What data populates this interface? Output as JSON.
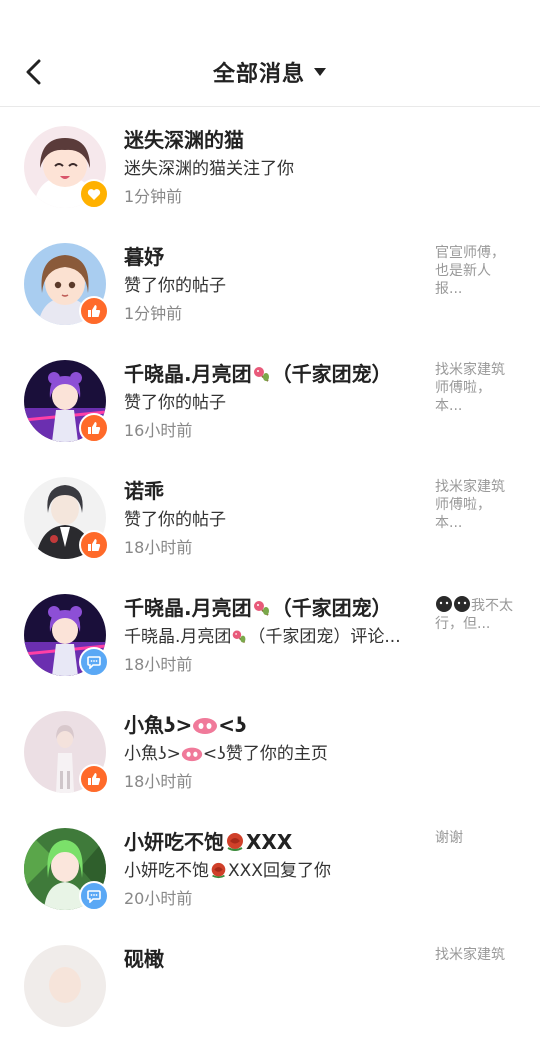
{
  "header": {
    "title": "全部消息"
  },
  "notifications": [
    {
      "name": "迷失深渊的猫",
      "action": "迷失深渊的猫关注了你",
      "time": "1分钟前",
      "preview": "",
      "badge": "heart-icon"
    },
    {
      "name": "暮妤",
      "action": "赞了你的帖子",
      "time": "1分钟前",
      "preview": "官宣师傅，也是新人报...",
      "badge": "thumbs-up-icon"
    },
    {
      "name": "千晓晶.月亮团",
      "name_suffix": "（千家团宠）",
      "action": "赞了你的帖子",
      "time": "16小时前",
      "preview": "找米家建筑师傅啦，本...",
      "badge": "thumbs-up-icon"
    },
    {
      "name": "诺乖",
      "action": "赞了你的帖子",
      "time": "18小时前",
      "preview": "找米家建筑师傅啦，本...",
      "badge": "thumbs-up-icon"
    },
    {
      "name": "千晓晶.月亮团",
      "name_suffix": "（千家团宠）",
      "action": "千晓晶.月亮团",
      "action_suffix": "（千家团宠）评论...",
      "time": "18小时前",
      "preview": "我不太行，但...",
      "badge": "comment-icon"
    },
    {
      "name": "小魚ʖ>",
      "name_suffix": "<ʖ",
      "action": "小魚ʖ>",
      "action_suffix": "<ʖ赞了你的主页",
      "time": "18小时前",
      "preview": "",
      "badge": "thumbs-up-icon"
    },
    {
      "name": "小妍吃不饱",
      "name_suffix": "XXX",
      "action": "小妍吃不饱",
      "action_suffix": "XXX回复了你",
      "time": "20小时前",
      "preview": "谢谢",
      "badge": "comment-icon"
    },
    {
      "name": "砚橄",
      "action": "",
      "time": "",
      "preview": "找米家建筑",
      "badge": ""
    }
  ]
}
